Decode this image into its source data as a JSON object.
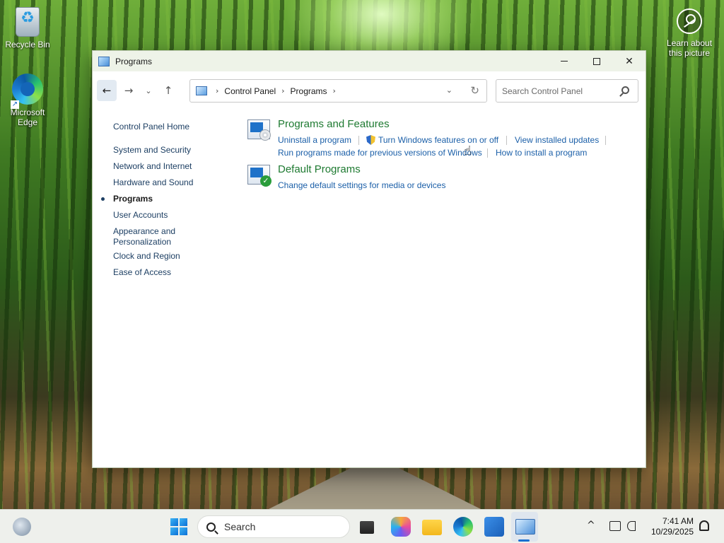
{
  "desktop": {
    "recycle_bin_label": "Recycle Bin",
    "edge_label": "Microsoft Edge",
    "learn_label": "Learn about this picture"
  },
  "window": {
    "title": "Programs",
    "minimize_glyph": "—",
    "maximize_glyph": "",
    "close_glyph": "✕"
  },
  "nav": {
    "back_glyph": "←",
    "forward_glyph": "→",
    "recent_glyph": "⌄",
    "up_glyph": "↑",
    "breadcrumb": [
      "Control Panel",
      "Programs"
    ],
    "breadcrumb_sep": "›",
    "dropdown_glyph": "⌄",
    "refresh_glyph": "↻",
    "search_placeholder": "Search Control Panel"
  },
  "sidebar": {
    "home": "Control Panel Home",
    "items": [
      {
        "label": "System and Security",
        "active": false
      },
      {
        "label": "Network and Internet",
        "active": false
      },
      {
        "label": "Hardware and Sound",
        "active": false
      },
      {
        "label": "Programs",
        "active": true
      },
      {
        "label": "User Accounts",
        "active": false
      },
      {
        "label": "Appearance and",
        "active": false
      },
      {
        "label": "Personalization",
        "active": false
      },
      {
        "label": "Clock and Region",
        "active": false
      },
      {
        "label": "Ease of Access",
        "active": false
      }
    ]
  },
  "categories": [
    {
      "title": "Programs and Features",
      "icon": "programs-features-icon",
      "links": [
        "Uninstall a program",
        "Turn Windows features on or off",
        "View installed updates",
        "Run programs made for previous versions of Windows",
        "How to install a program"
      ]
    },
    {
      "title": "Default Programs",
      "icon": "default-programs-icon",
      "links": [
        "Change default settings for media or devices"
      ]
    }
  ],
  "taskbar": {
    "search_label": "Search",
    "time": "7:41 AM",
    "date": "10/29/2025",
    "tray_chevron": "^"
  },
  "colors": {
    "link_blue": "#1b5fa8",
    "category_green": "#1e7a31",
    "accent": "#1a6fd0"
  }
}
